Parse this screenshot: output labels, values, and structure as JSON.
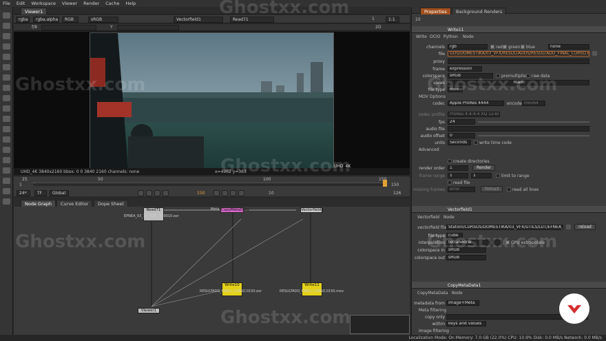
{
  "menu": [
    "File",
    "Edit",
    "Workspace",
    "Viewer",
    "Render",
    "Cache",
    "Help"
  ],
  "viewer": {
    "tab": "Viewer1",
    "channels": "rgba",
    "alpha": "rgba.alpha",
    "colorspace_short": "RGB",
    "display": "sRGB",
    "a_input": "Vectorfield1",
    "b_input": "Read71",
    "fstop_label": "f/8",
    "frame_current": "1",
    "zoom": "1:1",
    "mode_2d": "2D",
    "y_label": "Y",
    "zero": "0",
    "overlay_br": "UHD_4K",
    "info_left": "UHD_4K  3840x2160   bbox: 0 0 3840 2160 channels: none",
    "info_coords": "x=4962 y=363"
  },
  "timeline": {
    "ticks": [
      "25",
      "50",
      "100",
      "150"
    ],
    "start": "1",
    "end": "126",
    "current": "150",
    "fps": "24*",
    "tf": "TF",
    "scope": "Global",
    "step": "10",
    "end_marker": "150"
  },
  "nodegraph": {
    "tabs": [
      "Node Graph",
      "Curve Editor",
      "Dope Sheet"
    ],
    "read_node": "Read71",
    "read_label": "EPNEA_03_10_FL01_000010.exr",
    "copy_node": "CopyMetaData",
    "meta_label": "Meta",
    "vf_node": "Vectorfield1",
    "write10": "Write10",
    "write10_label": "RESULTADO_FINAL_CURSO.0150.exr",
    "write11": "Write11",
    "write11_label": "RESULTADO_FINAL_CURSO.0150.mov",
    "viewer_node": "Viewer1"
  },
  "properties": {
    "tabs": [
      "Properties",
      "Background Renders"
    ],
    "count": "10",
    "write": {
      "name": "Write11",
      "subtabs": [
        "Write",
        "OCIO",
        "Python",
        "Node"
      ],
      "channels_label": "channels",
      "channels": "rgb",
      "red": "red",
      "green": "green",
      "blue": "blue",
      "none": "none",
      "file_label": "file",
      "file": "GOS/DOMESTIKA/03_VFX/RESULTADOS/RESULTADO_FINAL_CURSO.646.mov",
      "proxy_label": "proxy",
      "frame_label": "frame",
      "frame": "expression",
      "colorspace_label": "colorspace",
      "colorspace": "sRGB",
      "premultiplied": "premultiplied",
      "raw_data": "raw data",
      "views_label": "views",
      "views": "main",
      "filetype_label": "file type",
      "filetype": "mov",
      "mov_options": "MOV Options",
      "codec_label": "codec",
      "codec": "Apple ProRes 4444",
      "encoder_label": "encoder",
      "encoder": "mov64",
      "codec_profile_label": "codec profile",
      "codec_profile": "ProRes 4:4:4:4 XQ 12-bit",
      "fps_label": "fps",
      "fps": "24",
      "audio_file_label": "audio file",
      "audio_offset_label": "audio offset",
      "audio_offset": "0",
      "units_label": "units",
      "units": "Seconds",
      "write_timecode": "write time code",
      "advanced": "Advanced",
      "create_dirs": "create directories",
      "render_order_label": "render order",
      "render_order": "1",
      "render_btn": "Render",
      "frame_range_label": "frame range",
      "fr_a": "1",
      "fr_b": "1",
      "limit_range": "limit to range",
      "read_file": "read file",
      "missing_frames_label": "missing frames",
      "missing_frames": "error",
      "reload": "Reload",
      "read_all_lines": "read all lines"
    },
    "vector": {
      "name": "Vectorfield1",
      "subtabs": [
        "Vectorfield",
        "Node"
      ],
      "file_label": "vectorfield file",
      "file": "Station/CURSOS/DOMESTIKA/03_VFX/UTILS/LUT/EFNEA_1.cube",
      "reload": "reload",
      "filetype_label": "file type",
      "filetype": "cube",
      "interp_label": "interpolation",
      "interp": "tetrahedral",
      "gpu": "GPU extrapolate",
      "cs_in_label": "colorspace in",
      "cs_in": "sRGB",
      "cs_out_label": "colorspace out",
      "cs_out": "sRGB"
    },
    "copymeta": {
      "name": "CopyMetaData1",
      "subtabs": [
        "CopyMetaData",
        "Node"
      ],
      "from_label": "metadata from",
      "from": "Image+Meta",
      "filtering": "Meta filtering",
      "copy_only_label": "copy only",
      "within_label": "within",
      "within": "keys and values",
      "image_filtering": "Image filtering"
    }
  },
  "status": "Localization Mode: On  Memory: 7.0 GB (22.0%)  CPU: 10.9%  Disk: 0.0 MB/s  Network: 0.0 MB/s",
  "watermark": "Ghostxx.com",
  "colors": {
    "accent": "#a2501f",
    "node_yellow": "#e4d21a",
    "node_pink": "#d869c8",
    "logo_red": "#d62d2d"
  }
}
